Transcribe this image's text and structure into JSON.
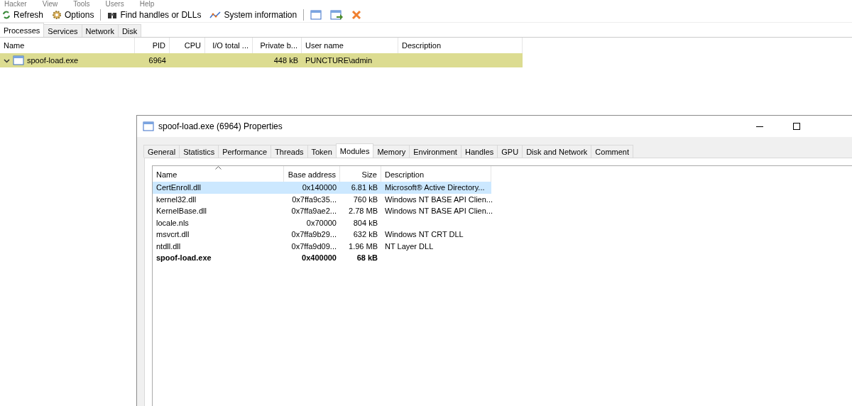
{
  "menu": [
    "Hacker",
    "View",
    "Tools",
    "Users",
    "Help"
  ],
  "toolbar": [
    {
      "label": "Refresh",
      "kind": "refresh"
    },
    {
      "label": "Options",
      "kind": "options"
    },
    {
      "label": "Find handles or DLLs",
      "kind": "find"
    },
    {
      "label": "System information",
      "kind": "sysinfo"
    },
    {
      "kind": "window"
    },
    {
      "kind": "window-arrow"
    },
    {
      "kind": "close"
    }
  ],
  "tabs": [
    {
      "label": "Processes",
      "selected": true
    },
    {
      "label": "Services",
      "selected": false
    },
    {
      "label": "Network",
      "selected": false
    },
    {
      "label": "Disk",
      "selected": false
    }
  ],
  "processes": {
    "columns": [
      "Name",
      "PID",
      "CPU",
      "I/O total ...",
      "Private b...",
      "User name",
      "Description"
    ],
    "rows": [
      {
        "name": "spoof-load.exe",
        "expanded": true,
        "pid": "6964",
        "private": "448 kB",
        "user": "PUNCTURE\\admin",
        "color": "#dcdc91"
      }
    ]
  },
  "properties": {
    "title": "spoof-load.exe (6964) Properties",
    "tabs": [
      {
        "label": "General",
        "selected": false
      },
      {
        "label": "Statistics",
        "selected": false
      },
      {
        "label": "Performance",
        "selected": false
      },
      {
        "label": "Threads",
        "selected": false
      },
      {
        "label": "Token",
        "selected": false
      },
      {
        "label": "Modules",
        "selected": true
      },
      {
        "label": "Memory",
        "selected": false
      },
      {
        "label": "Environment",
        "selected": false
      },
      {
        "label": "Handles",
        "selected": false
      },
      {
        "label": "GPU",
        "selected": false
      },
      {
        "label": "Disk and Network",
        "selected": false
      },
      {
        "label": "Comment",
        "selected": false
      }
    ],
    "columns": [
      "Name",
      "Base address",
      "Size",
      "Description"
    ],
    "modules": [
      {
        "name": "CertEnroll.dll",
        "base": "0x140000",
        "size": "6.81 kB",
        "description": "Microsoft® Active Directory...",
        "selected": true,
        "kind": "module"
      },
      {
        "name": "kernel32.dll",
        "base": "0x7ffa9c35...",
        "size": "760 kB",
        "description": "Windows NT BASE API Clien...",
        "selected": false,
        "kind": "module"
      },
      {
        "name": "KernelBase.dll",
        "base": "0x7ffa9ae2...",
        "size": "2.78 MB",
        "description": "Windows NT BASE API Clien...",
        "selected": false,
        "kind": "module"
      },
      {
        "name": "locale.nls",
        "base": "0x70000",
        "size": "804 kB",
        "selected": false,
        "kind": "module"
      },
      {
        "name": "msvcrt.dll",
        "base": "0x7ffa9b29...",
        "size": "632 kB",
        "description": "Windows NT CRT DLL",
        "selected": false,
        "kind": "module"
      },
      {
        "name": "ntdll.dll",
        "base": "0x7ffa9d09...",
        "size": "1.96 MB",
        "description": "NT Layer DLL",
        "selected": false,
        "kind": "module"
      },
      {
        "name": "spoof-load.exe",
        "base": "0x400000",
        "size": "68 kB",
        "selected": false,
        "kind": "main"
      }
    ]
  }
}
